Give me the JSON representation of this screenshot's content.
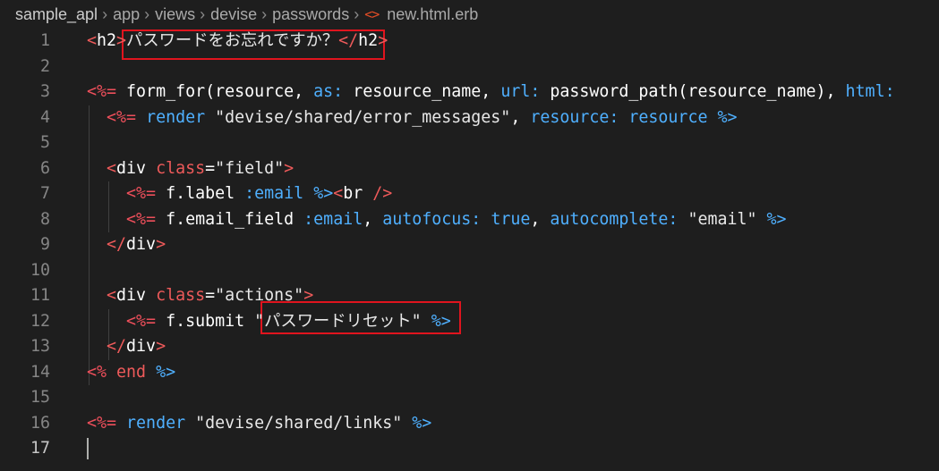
{
  "breadcrumb": {
    "items": [
      "sample_apl",
      "app",
      "views",
      "devise",
      "passwords"
    ],
    "file_icon": "<>",
    "file": "new.html.erb"
  },
  "editor": {
    "current_line": 17,
    "lines": [
      {
        "n": "1",
        "tokens": [
          {
            "c": "t-red",
            "t": "<"
          },
          {
            "c": "t-white",
            "t": "h2"
          },
          {
            "c": "t-red",
            "t": ">"
          },
          {
            "c": "t-strw",
            "t": "パスワードをお忘れですか？"
          },
          {
            "c": "t-red",
            "t": "</"
          },
          {
            "c": "t-white",
            "t": "h2"
          },
          {
            "c": "t-red",
            "t": ">"
          }
        ]
      },
      {
        "n": "2",
        "tokens": []
      },
      {
        "n": "3",
        "tokens": [
          {
            "c": "t-erb",
            "t": "<%="
          },
          {
            "c": "t-plain",
            "t": " "
          },
          {
            "c": "t-white",
            "t": "form_for(resource, "
          },
          {
            "c": "t-key",
            "t": "as:"
          },
          {
            "c": "t-white",
            "t": " resource_name, "
          },
          {
            "c": "t-key",
            "t": "url:"
          },
          {
            "c": "t-white",
            "t": " password_path(resource_name), "
          },
          {
            "c": "t-key",
            "t": "html:"
          }
        ]
      },
      {
        "n": "4",
        "tokens": [
          {
            "c": "t-plain",
            "t": "  "
          },
          {
            "c": "t-erb",
            "t": "<%="
          },
          {
            "c": "t-plain",
            "t": " "
          },
          {
            "c": "t-key",
            "t": "render"
          },
          {
            "c": "t-plain",
            "t": " "
          },
          {
            "c": "t-strw",
            "t": "\"devise/shared/error_messages\""
          },
          {
            "c": "t-white",
            "t": ", "
          },
          {
            "c": "t-key",
            "t": "resource:"
          },
          {
            "c": "t-plain",
            "t": " "
          },
          {
            "c": "t-key",
            "t": "resource"
          },
          {
            "c": "t-plain",
            "t": " "
          },
          {
            "c": "t-key",
            "t": "%>"
          }
        ]
      },
      {
        "n": "5",
        "tokens": []
      },
      {
        "n": "6",
        "tokens": [
          {
            "c": "t-plain",
            "t": "  "
          },
          {
            "c": "t-red",
            "t": "<"
          },
          {
            "c": "t-white",
            "t": "div"
          },
          {
            "c": "t-plain",
            "t": " "
          },
          {
            "c": "t-red",
            "t": "class"
          },
          {
            "c": "t-white",
            "t": "="
          },
          {
            "c": "t-strw",
            "t": "\"field\""
          },
          {
            "c": "t-red",
            "t": ">"
          }
        ]
      },
      {
        "n": "7",
        "tokens": [
          {
            "c": "t-plain",
            "t": "    "
          },
          {
            "c": "t-erb",
            "t": "<%="
          },
          {
            "c": "t-plain",
            "t": " "
          },
          {
            "c": "t-white",
            "t": "f.label "
          },
          {
            "c": "t-key",
            "t": ":email"
          },
          {
            "c": "t-plain",
            "t": " "
          },
          {
            "c": "t-key",
            "t": "%>"
          },
          {
            "c": "t-red",
            "t": "<"
          },
          {
            "c": "t-white",
            "t": "br"
          },
          {
            "c": "t-plain",
            "t": " "
          },
          {
            "c": "t-red",
            "t": "/>"
          }
        ]
      },
      {
        "n": "8",
        "tokens": [
          {
            "c": "t-plain",
            "t": "    "
          },
          {
            "c": "t-erb",
            "t": "<%="
          },
          {
            "c": "t-plain",
            "t": " "
          },
          {
            "c": "t-white",
            "t": "f.email_field "
          },
          {
            "c": "t-key",
            "t": ":email"
          },
          {
            "c": "t-white",
            "t": ", "
          },
          {
            "c": "t-key",
            "t": "autofocus:"
          },
          {
            "c": "t-plain",
            "t": " "
          },
          {
            "c": "t-key",
            "t": "true"
          },
          {
            "c": "t-white",
            "t": ", "
          },
          {
            "c": "t-key",
            "t": "autocomplete:"
          },
          {
            "c": "t-plain",
            "t": " "
          },
          {
            "c": "t-strw",
            "t": "\"email\""
          },
          {
            "c": "t-plain",
            "t": " "
          },
          {
            "c": "t-key",
            "t": "%>"
          }
        ]
      },
      {
        "n": "9",
        "tokens": [
          {
            "c": "t-plain",
            "t": "  "
          },
          {
            "c": "t-red",
            "t": "</"
          },
          {
            "c": "t-white",
            "t": "div"
          },
          {
            "c": "t-red",
            "t": ">"
          }
        ]
      },
      {
        "n": "10",
        "tokens": []
      },
      {
        "n": "11",
        "tokens": [
          {
            "c": "t-plain",
            "t": "  "
          },
          {
            "c": "t-red",
            "t": "<"
          },
          {
            "c": "t-white",
            "t": "div"
          },
          {
            "c": "t-plain",
            "t": " "
          },
          {
            "c": "t-red",
            "t": "class"
          },
          {
            "c": "t-white",
            "t": "="
          },
          {
            "c": "t-strw",
            "t": "\"actions\""
          },
          {
            "c": "t-red",
            "t": ">"
          }
        ]
      },
      {
        "n": "12",
        "tokens": [
          {
            "c": "t-plain",
            "t": "    "
          },
          {
            "c": "t-erb",
            "t": "<%="
          },
          {
            "c": "t-plain",
            "t": " "
          },
          {
            "c": "t-white",
            "t": "f.submit "
          },
          {
            "c": "t-strw",
            "t": "\"パスワードリセット\""
          },
          {
            "c": "t-plain",
            "t": " "
          },
          {
            "c": "t-key",
            "t": "%>"
          }
        ]
      },
      {
        "n": "13",
        "tokens": [
          {
            "c": "t-plain",
            "t": "  "
          },
          {
            "c": "t-red",
            "t": "</"
          },
          {
            "c": "t-white",
            "t": "div"
          },
          {
            "c": "t-red",
            "t": ">"
          }
        ]
      },
      {
        "n": "14",
        "tokens": [
          {
            "c": "t-erb",
            "t": "<%"
          },
          {
            "c": "t-plain",
            "t": " "
          },
          {
            "c": "t-red",
            "t": "end"
          },
          {
            "c": "t-plain",
            "t": " "
          },
          {
            "c": "t-key",
            "t": "%>"
          }
        ]
      },
      {
        "n": "15",
        "tokens": []
      },
      {
        "n": "16",
        "tokens": [
          {
            "c": "t-erb",
            "t": "<%="
          },
          {
            "c": "t-plain",
            "t": " "
          },
          {
            "c": "t-key",
            "t": "render"
          },
          {
            "c": "t-plain",
            "t": " "
          },
          {
            "c": "t-strw",
            "t": "\"devise/shared/links\""
          },
          {
            "c": "t-plain",
            "t": " "
          },
          {
            "c": "t-key",
            "t": "%>"
          }
        ]
      },
      {
        "n": "17",
        "tokens": []
      }
    ]
  },
  "colors": {
    "background": "#1e1e1e",
    "highlight_box": "#e0141e",
    "line_number": "#858585",
    "erb_delimiter": "#ee4f5b",
    "keyword_blue": "#4fb0ff"
  }
}
